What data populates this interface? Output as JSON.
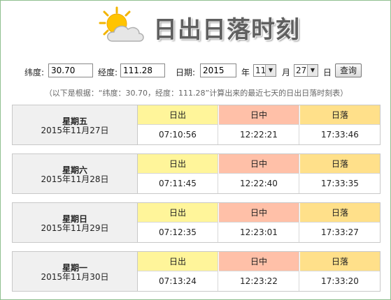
{
  "header": {
    "title": "日出日落时刻",
    "icon": "partly-cloudy-sun-icon"
  },
  "form": {
    "lat_label": "纬度:",
    "lat_value": "30.70",
    "lng_label": "经度:",
    "lng_value": "111.28",
    "date_label": "日期:",
    "year_value": "2015",
    "year_unit": "年",
    "month_value": "11",
    "month_unit": "月",
    "day_value": "27",
    "day_unit": "日",
    "query_label": "查询"
  },
  "note": "（以下是根据：“纬度：30.70，经度：111.28”计算出来的最近七天的日出日落时刻表）",
  "columns": {
    "sunrise": "日出",
    "noon": "日中",
    "sunset": "日落"
  },
  "days": [
    {
      "weekday": "星期五",
      "date": "2015年11月27日",
      "sunrise": "07:10:56",
      "noon": "12:22:21",
      "sunset": "17:33:46"
    },
    {
      "weekday": "星期六",
      "date": "2015年11月28日",
      "sunrise": "07:11:45",
      "noon": "12:22:40",
      "sunset": "17:33:35"
    },
    {
      "weekday": "星期日",
      "date": "2015年11月29日",
      "sunrise": "07:12:35",
      "noon": "12:23:01",
      "sunset": "17:33:27"
    },
    {
      "weekday": "星期一",
      "date": "2015年11月30日",
      "sunrise": "07:13:24",
      "noon": "12:23:22",
      "sunset": "17:33:20"
    }
  ],
  "colors": {
    "sunrise": "#fff59a",
    "noon": "#ffc0a8",
    "sunset": "#ffe08a",
    "border": "#8fbf8f"
  }
}
